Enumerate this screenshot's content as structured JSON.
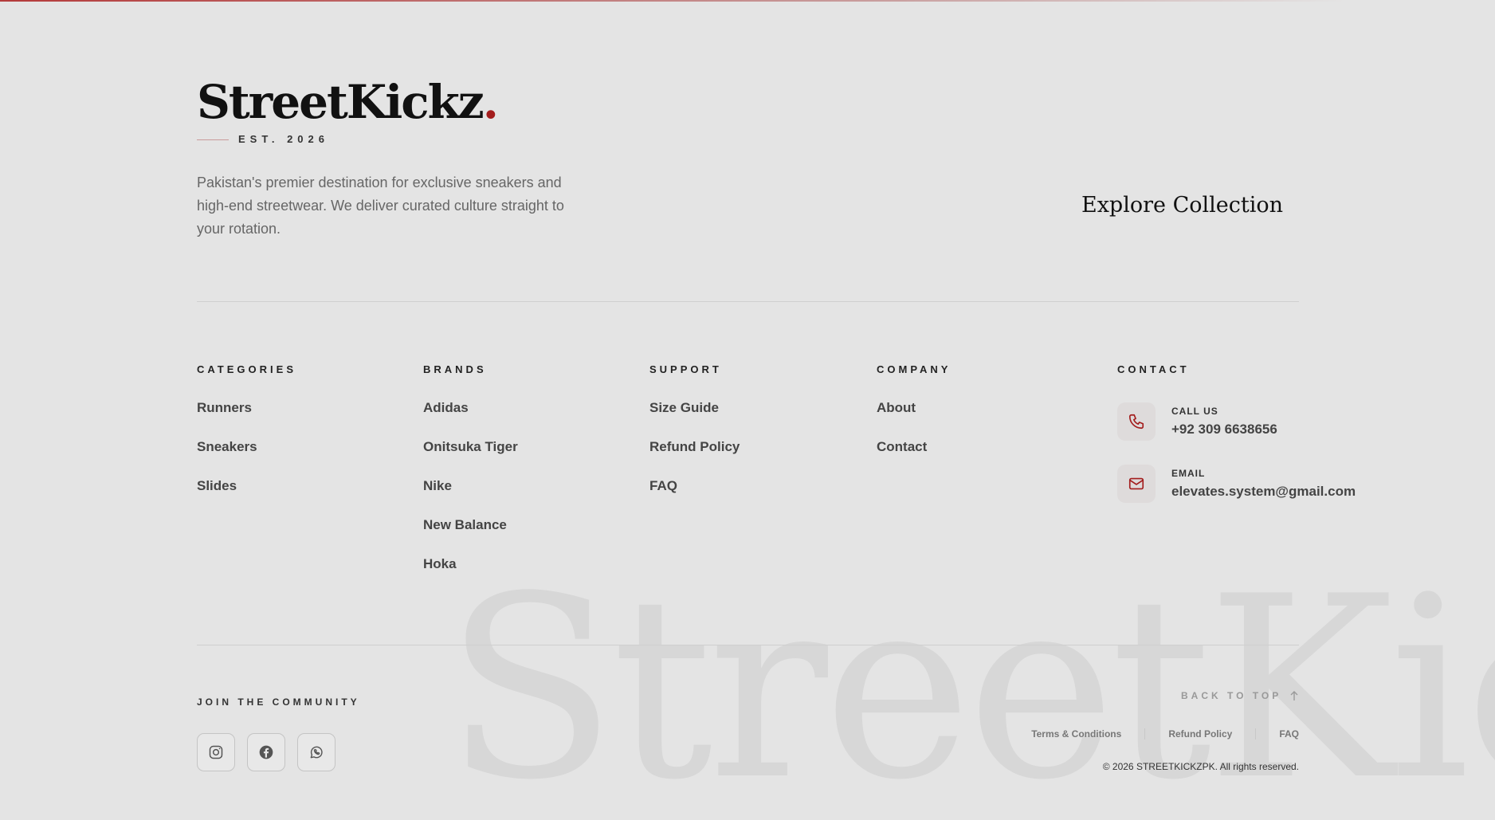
{
  "brand": {
    "name": "StreetKickz",
    "dot": ".",
    "est": "EST. 2026",
    "accent": "#a31d1d"
  },
  "intro": {
    "description": "Pakistan's premier destination for exclusive sneakers and high-end streetwear. We deliver curated culture straight to your rotation."
  },
  "explore": {
    "label": "Explore Collection",
    "icon": "arrow-up-right-icon"
  },
  "columns": {
    "categories": {
      "heading": "CATEGORIES",
      "links": [
        "Runners",
        "Sneakers",
        "Slides"
      ]
    },
    "brands": {
      "heading": "BRANDS",
      "links": [
        "Adidas",
        "Onitsuka Tiger",
        "Nike",
        "New Balance",
        "Hoka"
      ]
    },
    "support": {
      "heading": "SUPPORT",
      "links": [
        "Size Guide",
        "Refund Policy",
        "FAQ"
      ]
    },
    "company": {
      "heading": "COMPANY",
      "links": [
        "About",
        "Contact"
      ]
    }
  },
  "contact": {
    "heading": "CONTACT",
    "phone": {
      "label": "CALL US",
      "value": "+92 309 6638656",
      "icon": "phone-icon"
    },
    "email": {
      "label": "EMAIL",
      "value": "elevates.system@gmail.com",
      "icon": "mail-icon"
    }
  },
  "community": {
    "heading": "JOIN THE COMMUNITY",
    "socials": [
      {
        "name": "instagram",
        "icon": "instagram-icon"
      },
      {
        "name": "facebook",
        "icon": "facebook-icon"
      },
      {
        "name": "whatsapp",
        "icon": "whatsapp-icon"
      }
    ]
  },
  "bottom": {
    "back_to_top": "BACK TO TOP",
    "legal": [
      "Terms & Conditions",
      "Refund Policy",
      "FAQ"
    ],
    "copyright": "© 2026 STREETKICKZPK. All rights reserved."
  },
  "watermark": "StreetKickz"
}
